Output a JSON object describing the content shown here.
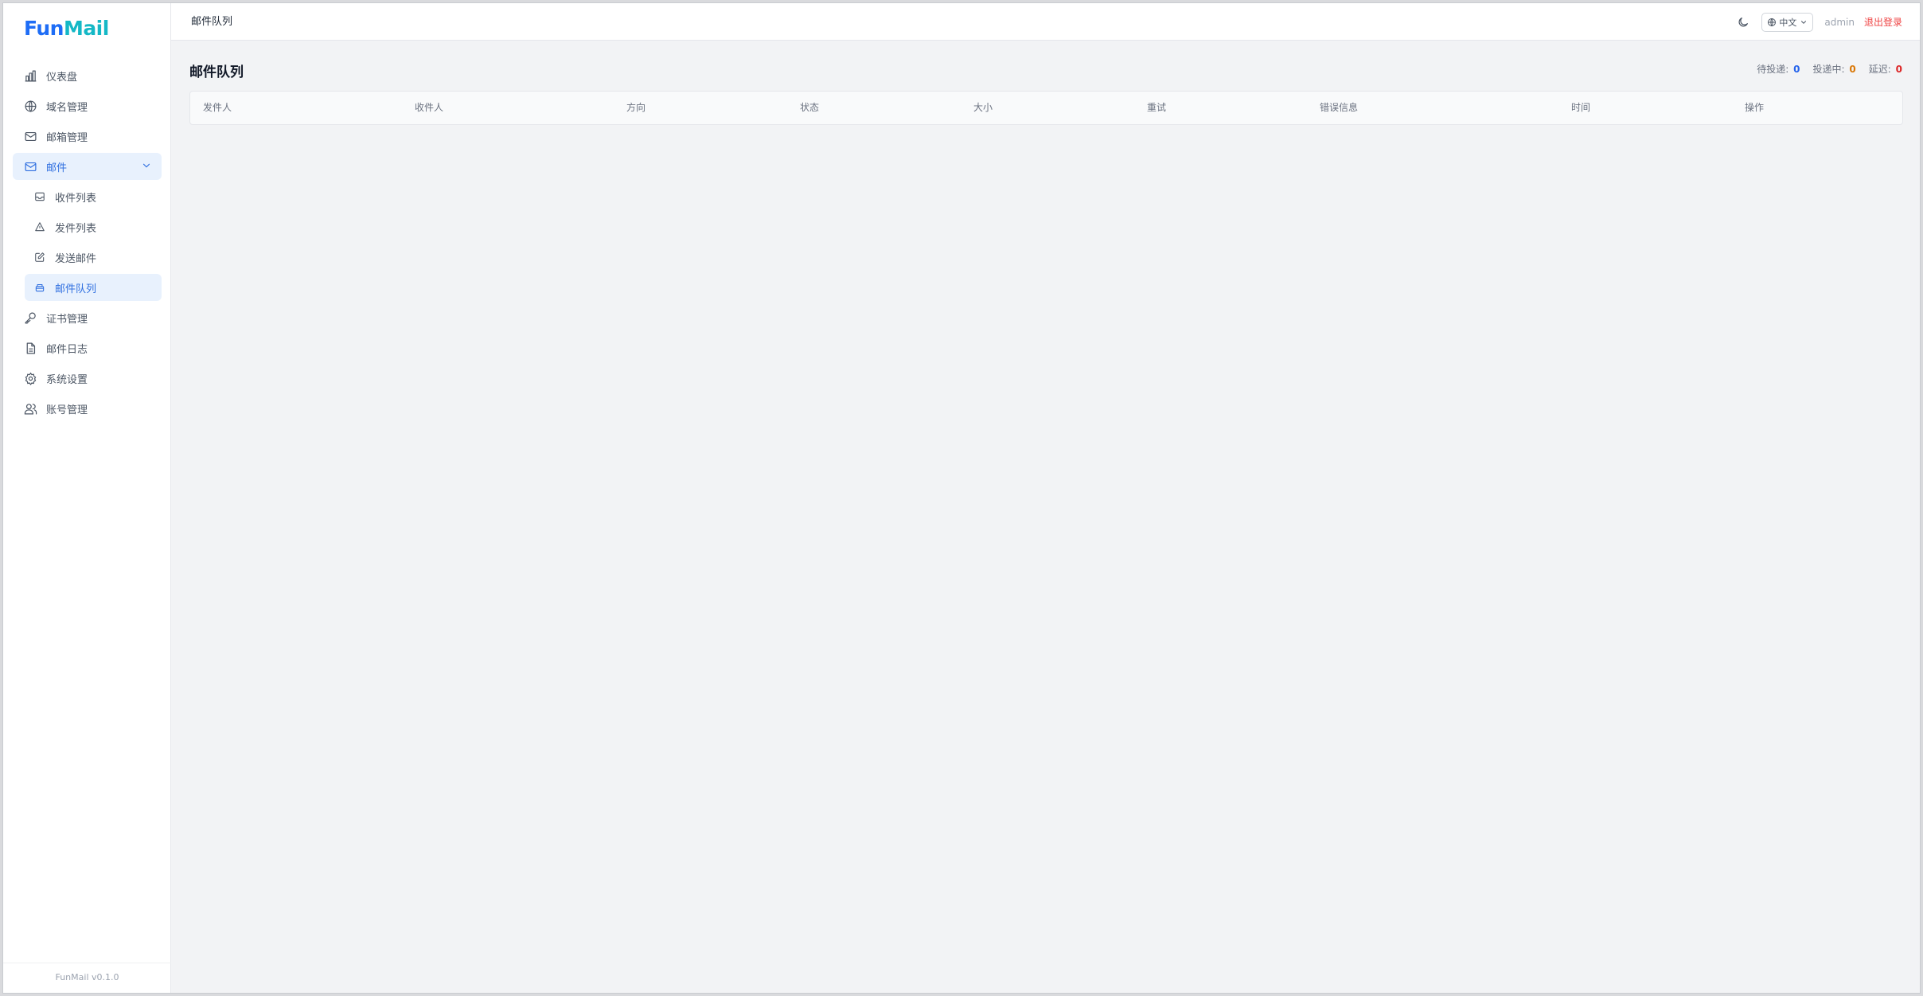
{
  "brand": {
    "logo_part1": "Fun",
    "logo_part2": "Mail",
    "accent": "#1e6df6",
    "accent2": "#14b8c6"
  },
  "sidebar": {
    "items": [
      {
        "label": "仪表盘",
        "icon": "bar-chart-icon"
      },
      {
        "label": "域名管理",
        "icon": "globe-icon"
      },
      {
        "label": "邮箱管理",
        "icon": "mail-icon"
      },
      {
        "label": "邮件",
        "icon": "mail-icon",
        "expanded": true
      },
      {
        "label": "证书管理",
        "icon": "key-icon"
      },
      {
        "label": "邮件日志",
        "icon": "file-text-icon"
      },
      {
        "label": "系统设置",
        "icon": "gear-icon"
      },
      {
        "label": "账号管理",
        "icon": "users-icon"
      }
    ],
    "sub_items": [
      {
        "label": "收件列表",
        "icon": "inbox-icon"
      },
      {
        "label": "发件列表",
        "icon": "send-icon"
      },
      {
        "label": "发送邮件",
        "icon": "edit-icon"
      },
      {
        "label": "邮件队列",
        "icon": "queue-icon",
        "active": true
      }
    ],
    "footer": "FunMail v0.1.0"
  },
  "header": {
    "title": "邮件队列",
    "theme_icon": "moon-icon",
    "language": "中文",
    "user": "admin",
    "logout": "退出登录"
  },
  "main": {
    "title": "邮件队列",
    "stats": {
      "pending_label": "待投递:",
      "pending_value": "0",
      "delivering_label": "投递中:",
      "delivering_value": "0",
      "deferred_label": "延迟:",
      "deferred_value": "0"
    },
    "table": {
      "columns": [
        "发件人",
        "收件人",
        "方向",
        "状态",
        "大小",
        "重试",
        "错误信息",
        "时间",
        "操作"
      ],
      "rows": []
    }
  }
}
